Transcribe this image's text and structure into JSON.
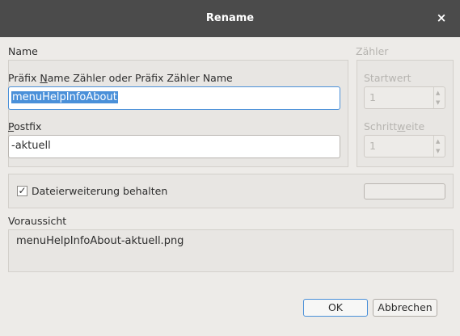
{
  "window": {
    "title": "Rename",
    "close_glyph": "×"
  },
  "name_section": {
    "label": "Name",
    "prefix_label_pre": "Präfix ",
    "prefix_label_mnemonic": "N",
    "prefix_label_post": "ame Zähler oder Präfix Zähler Name",
    "prefix_value": "menuHelpInfoAbout",
    "postfix_label_mnemonic": "P",
    "postfix_label_post": "ostfix",
    "postfix_value": "-aktuell"
  },
  "counter_section": {
    "label": "Zähler",
    "start_label": "Startwert",
    "start_value": "1",
    "step_label_pre": "Schritt",
    "step_label_mnemonic": "w",
    "step_label_post": "eite",
    "step_value": "1"
  },
  "options": {
    "keep_extension_checked": true,
    "check_glyph": "✓",
    "keep_extension_label": "Dateierweiterung behalten"
  },
  "preview": {
    "label": "Voraussicht",
    "value": "menuHelpInfoAbout-aktuell.png"
  },
  "buttons": {
    "ok": "OK",
    "cancel": "Abbrechen"
  },
  "icons": {
    "close": "close-icon",
    "spin_up": "spin-up-icon",
    "spin_down": "spin-down-icon",
    "check": "check-icon"
  },
  "colors": {
    "titlebar": "#4b4b4b",
    "accent": "#4a90d9",
    "window_bg": "#edebe8"
  }
}
